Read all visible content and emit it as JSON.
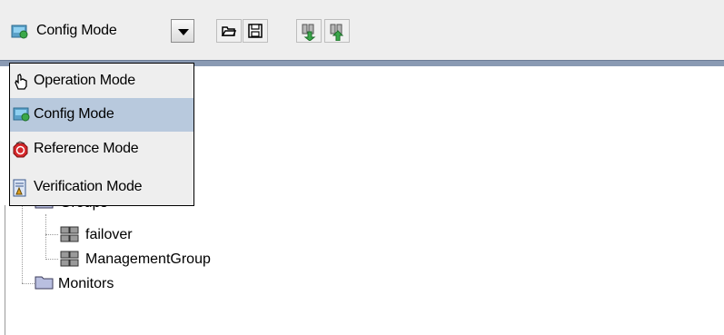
{
  "toolbar": {
    "mode_combo": {
      "selected": "Config Mode",
      "icon": "config-mode-icon"
    },
    "buttons": [
      {
        "name": "open-button",
        "icon": "folder-open-icon"
      },
      {
        "name": "save-button",
        "icon": "floppy-disk-icon"
      },
      {
        "name": "download-button",
        "icon": "download-arrow-icon"
      },
      {
        "name": "upload-button",
        "icon": "upload-arrow-icon"
      }
    ]
  },
  "dropdown": {
    "items": [
      {
        "label": "Operation Mode",
        "icon": "hand-cursor-icon",
        "selected": false
      },
      {
        "label": "Config Mode",
        "icon": "config-mode-icon",
        "selected": true
      },
      {
        "label": "Reference Mode",
        "icon": "stop-sign-icon",
        "selected": false
      },
      {
        "label": "Verification Mode",
        "icon": "document-check-icon",
        "selected": false
      }
    ]
  },
  "tree": {
    "groups_label": "Groups",
    "children": [
      {
        "label": "failover",
        "icon": "server-group-icon"
      },
      {
        "label": "ManagementGroup",
        "icon": "server-group-icon"
      }
    ],
    "monitors_label": "Monitors"
  },
  "colors": {
    "selection": "#b8c9dd",
    "toolbar_separator": "#8a9ab3",
    "folder": "#b9bfe0"
  }
}
